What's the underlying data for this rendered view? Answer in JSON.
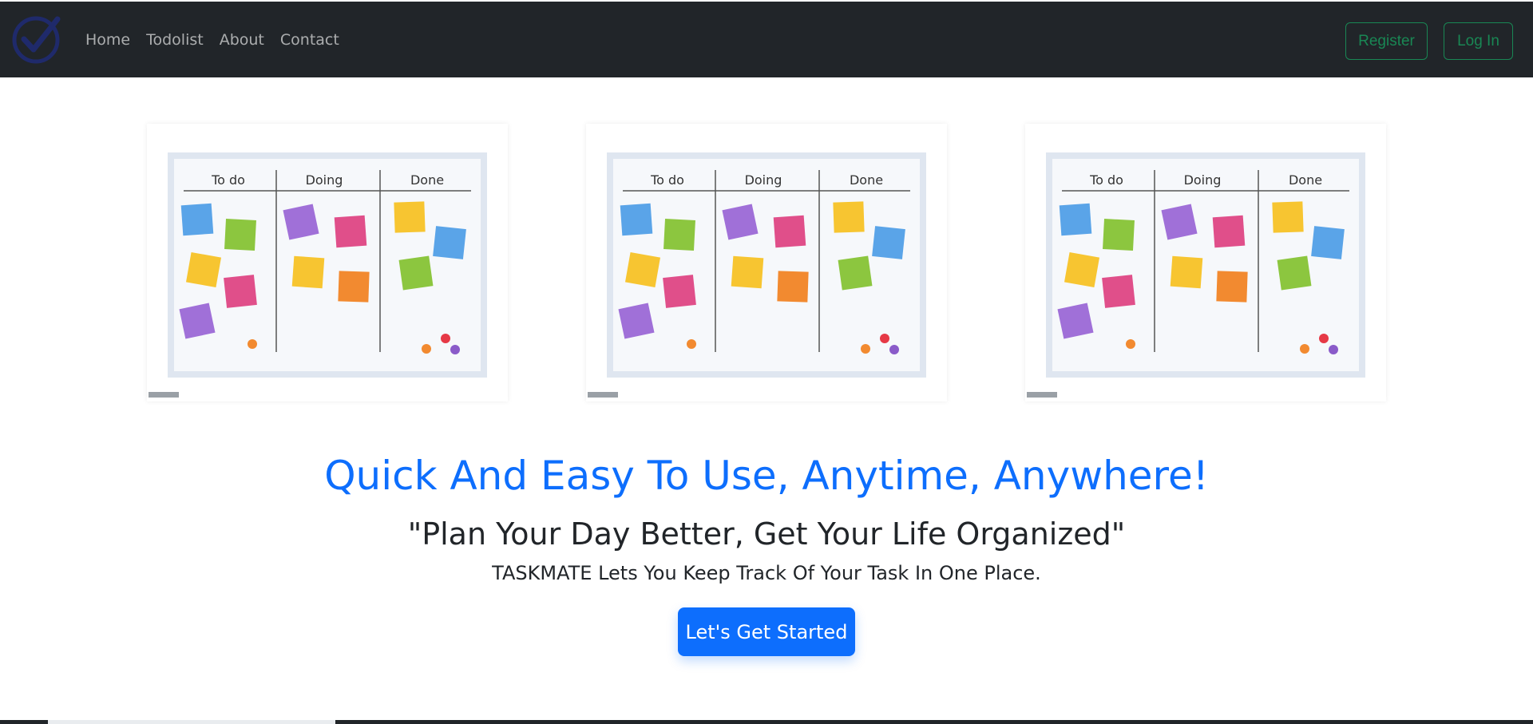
{
  "navbar": {
    "logo_icon": "check-circle-icon",
    "links": [
      "Home",
      "Todolist",
      "About",
      "Contact"
    ],
    "register_label": "Register",
    "login_label": "Log In"
  },
  "board": {
    "columns": [
      "To do",
      "Doing",
      "Done"
    ]
  },
  "hero": {
    "headline": "Quick And Easy To Use, Anytime, Anywhere!",
    "subhead": "\"Plan Your Day Better, Get Your Life Organized\"",
    "tagline": "TASKMATE Lets You Keep Track Of Your Task In One Place.",
    "cta_label": "Let's Get Started"
  },
  "colors": {
    "navbar_bg": "#212529",
    "accent_blue": "#0d6efd",
    "success_green": "#198754"
  }
}
